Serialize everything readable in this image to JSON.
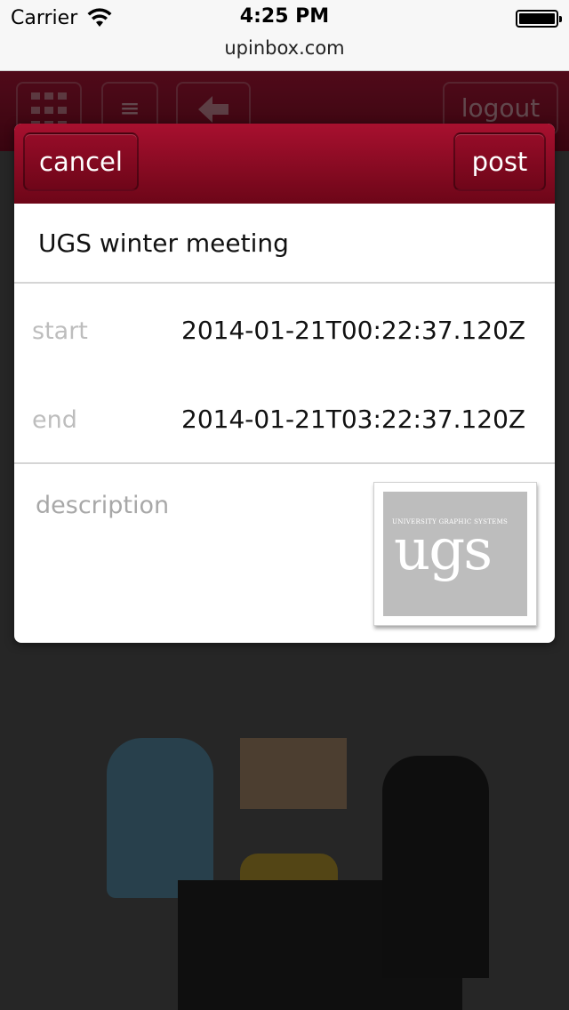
{
  "status_bar": {
    "carrier": "Carrier",
    "time": "4:25 PM",
    "url": "upinbox.com"
  },
  "background_app": {
    "header": {
      "grid_icon": "grid-icon",
      "menu_icon": "menu-icon",
      "back_icon": "back-arrow-icon",
      "logout_label": "logout"
    },
    "brand_color": "#9a0d2c"
  },
  "modal": {
    "cancel_label": "cancel",
    "post_label": "post",
    "title": "UGS winter meeting",
    "start_label": "start",
    "start_value": "2014-01-21T00:22:37.120Z",
    "end_label": "end",
    "end_value": "2014-01-21T03:22:37.120Z",
    "description_placeholder": "description",
    "thumbnail": {
      "small_text": "UNIVERSITY GRAPHIC SYSTEMS",
      "big_text": "ugs"
    }
  }
}
